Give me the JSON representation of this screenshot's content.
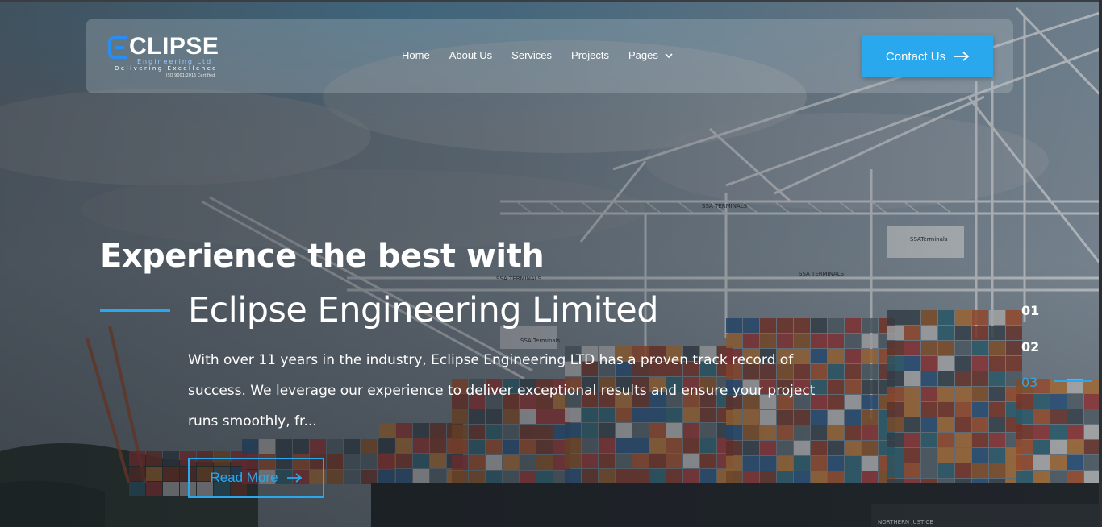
{
  "brand": {
    "logo_word": "CLIPSE",
    "logo_sub": "Engineering Ltd",
    "tagline": "Delivering  Excellence",
    "iso": "ISO 9001:2015 Certified",
    "accent_color": "#2aa8ee"
  },
  "nav": {
    "items": [
      {
        "label": "Home"
      },
      {
        "label": "About Us"
      },
      {
        "label": "Services"
      },
      {
        "label": "Projects"
      },
      {
        "label": "Pages"
      }
    ],
    "contact_label": "Contact Us",
    "chevron_icon": "chevron-down-icon",
    "arrow_icon": "arrow-right-icon"
  },
  "hero": {
    "headline": "Experience the best with",
    "company": "Eclipse Engineering Limited",
    "description": "With over 11 years in the industry, Eclipse Engineering LTD has a proven track record of success. We leverage our experience to deliver exceptional results and ensure your project runs smoothly, fr...",
    "read_more_label": "Read More"
  },
  "slides": {
    "items": [
      "01",
      "02",
      "03"
    ],
    "active_index": 2
  },
  "background_scene": {
    "crane_label_1": "SSA TERMINALS",
    "crane_label_2": "SSA TERMINALS",
    "crane_label_3": "SSA TERMINALS",
    "crane_label_4": "SSATerminals",
    "crane_label_5": "SSA Terminals",
    "ship_name": "NORTHERN   JUSTICE"
  }
}
